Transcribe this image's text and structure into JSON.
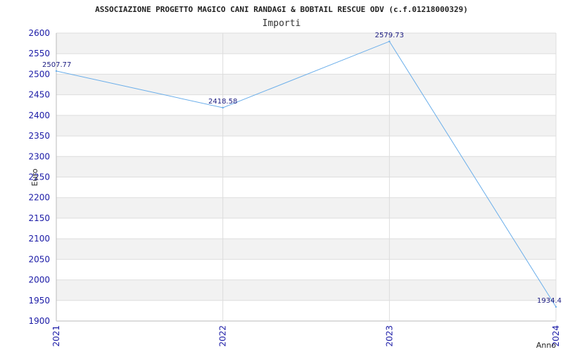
{
  "chart_data": {
    "type": "line",
    "title": "ASSOCIAZIONE PROGETTO MAGICO CANI RANDAGI & BOBTAIL RESCUE ODV (c.f.01218000329)",
    "subtitle": "Importi",
    "xlabel": "Anno",
    "ylabel": "Euro",
    "x": [
      "2021",
      "2022",
      "2023",
      "2024"
    ],
    "series": [
      {
        "values": [
          2507.77,
          2418.58,
          2579.73,
          1934.4
        ]
      }
    ],
    "data_labels": [
      "2507.77",
      "2418.58",
      "2579.73",
      "1934.4"
    ],
    "ylim": [
      1900,
      2600
    ],
    "yticks": [
      1900,
      1950,
      2000,
      2050,
      2100,
      2150,
      2200,
      2250,
      2300,
      2350,
      2400,
      2450,
      2500,
      2550,
      2600
    ],
    "grid": true,
    "colors": {
      "line": "#6aaeea",
      "band": "#f2f2f2",
      "grid": "#dddddd",
      "tick": "#1a1aa6"
    }
  }
}
